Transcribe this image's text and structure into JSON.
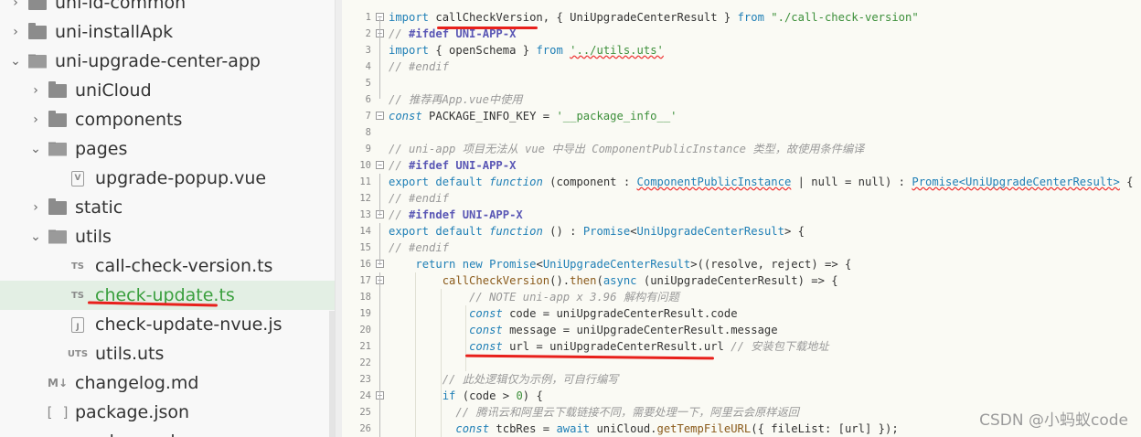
{
  "sidebar": {
    "items": [
      {
        "label": "uni-id-common",
        "chevron": "›",
        "icon": "folder-icon"
      },
      {
        "label": "uni-installApk",
        "chevron": "›",
        "icon": "folder-icon"
      },
      {
        "label": "uni-upgrade-center-app",
        "chevron": "⌄",
        "icon": "folder-open-icon"
      },
      {
        "label": "uniCloud",
        "chevron": "›",
        "icon": "folder-icon"
      },
      {
        "label": "components",
        "chevron": "›",
        "icon": "folder-icon"
      },
      {
        "label": "pages",
        "chevron": "⌄",
        "icon": "folder-open-icon"
      },
      {
        "label": "upgrade-popup.vue",
        "chevron": "",
        "icon": "vue-file-icon",
        "badge": "V"
      },
      {
        "label": "static",
        "chevron": "›",
        "icon": "folder-icon"
      },
      {
        "label": "utils",
        "chevron": "⌄",
        "icon": "folder-open-icon"
      },
      {
        "label": "call-check-version.ts",
        "chevron": "",
        "icon": "ts-file-icon",
        "badge": "TS"
      },
      {
        "label": "check-update.ts",
        "chevron": "",
        "icon": "ts-file-icon",
        "badge": "TS",
        "selected": true
      },
      {
        "label": "check-update-nvue.js",
        "chevron": "",
        "icon": "js-file-icon",
        "badge": "J"
      },
      {
        "label": "utils.uts",
        "chevron": "",
        "icon": "uts-file-icon",
        "badge": "UTS"
      },
      {
        "label": "changelog.md",
        "chevron": "",
        "icon": "md-file-icon",
        "badge": "M↓"
      },
      {
        "label": "package.json",
        "chevron": "",
        "icon": "json-file-icon",
        "badge": "[ ]"
      },
      {
        "label": "readme.md",
        "chevron": "",
        "icon": "md-file-icon",
        "badge": "M↓"
      }
    ]
  },
  "editor": {
    "lines": [
      {
        "n": "1",
        "fold": "−",
        "html": "<span class=\"kw\">import</span> callCheckVersion, { UniUpgradeCenterResult } <span class=\"kw\">from</span> <span class=\"str\">\"./call-check-version\"</span>"
      },
      {
        "n": "2",
        "fold": "−",
        "html": "<span class=\"cm\">// </span><span class=\"pp\">#ifdef UNI-APP-X</span>"
      },
      {
        "n": "3",
        "fold": "",
        "html": "<span class=\"kw\">import</span> { openSchema } <span class=\"kw\">from</span> <span class=\"str squig\">'../utils.uts'</span>"
      },
      {
        "n": "4",
        "fold": "",
        "html": "<span class=\"cm\">// #endif</span>"
      },
      {
        "n": "5",
        "fold": "",
        "html": ""
      },
      {
        "n": "6",
        "fold": "",
        "html": "<span class=\"cm\">// 推荐再App.vue中使用</span>"
      },
      {
        "n": "7",
        "fold": "−",
        "html": "<span class=\"it\">const</span> PACKAGE_INFO_KEY = <span class=\"str\">'__package_info__'</span>"
      },
      {
        "n": "8",
        "fold": "",
        "html": ""
      },
      {
        "n": "9",
        "fold": "",
        "html": "<span class=\"cm\">// uni-app 项目无法从 vue 中导出 ComponentPublicInstance 类型，故使用条件编译</span>"
      },
      {
        "n": "10",
        "fold": "−",
        "html": "<span class=\"cm\">// </span><span class=\"pp\">#ifdef UNI-APP-X</span>"
      },
      {
        "n": "11",
        "fold": "",
        "html": "<span class=\"kw\">export default</span> <span class=\"it\">function</span> (component : <span class=\"ty squig\">ComponentPublicInstance</span> | null = null) : <span class=\"ty squig\">Promise&lt;UniUpgradeCenterResult&gt;</span> {"
      },
      {
        "n": "12",
        "fold": "",
        "html": "<span class=\"cm\">// #endif</span>"
      },
      {
        "n": "13",
        "fold": "−",
        "html": "<span class=\"cm\">// </span><span class=\"pp\">#ifndef UNI-APP-X</span>"
      },
      {
        "n": "14",
        "fold": "",
        "html": "<span class=\"kw\">export default</span> <span class=\"it\">function</span> () : <span class=\"ty\">Promise</span>&lt;<span class=\"ty\">UniUpgradeCenterResult</span>&gt; {"
      },
      {
        "n": "15",
        "fold": "",
        "html": "<span class=\"cm\">// #endif</span>"
      },
      {
        "n": "16",
        "fold": "−",
        "html": "    <span class=\"kw\">return</span> <span class=\"kw\">new</span> <span class=\"ty\">Promise</span>&lt;<span class=\"ty\">UniUpgradeCenterResult</span>&gt;((resolve, reject) =&gt; {"
      },
      {
        "n": "17",
        "fold": "−",
        "html": "        <span class=\"fn\">callCheckVersion</span>().<span class=\"fn\">then</span>(<span class=\"kw\">async</span> (uniUpgradeCenterResult) =&gt; {"
      },
      {
        "n": "18",
        "fold": "",
        "html": "            <span class=\"cm\">// NOTE uni-app x 3.96 解构有问题</span>"
      },
      {
        "n": "19",
        "fold": "",
        "html": "            <span class=\"it\">const</span> code = uniUpgradeCenterResult.code"
      },
      {
        "n": "20",
        "fold": "",
        "html": "            <span class=\"it\">const</span> message = uniUpgradeCenterResult.message"
      },
      {
        "n": "21",
        "fold": "",
        "html": "            <span class=\"it\">const</span> url = uniUpgradeCenterResult.url <span class=\"cm\">// 安装包下载地址</span>"
      },
      {
        "n": "22",
        "fold": "",
        "html": ""
      },
      {
        "n": "23",
        "fold": "",
        "html": "        <span class=\"cm\">// 此处逻辑仅为示例，可自行编写</span>"
      },
      {
        "n": "24",
        "fold": "−",
        "html": "        <span class=\"kw\">if</span> (code &gt; <span class=\"str\">0</span>) {"
      },
      {
        "n": "25",
        "fold": "",
        "html": "          <span class=\"cm\">// 腾讯云和阿里云下载链接不同，需要处理一下，阿里云会原样返回</span>"
      },
      {
        "n": "26",
        "fold": "",
        "html": "          <span class=\"it\">const</span> tcbRes = <span class=\"kw\">await</span> uniCloud.<span class=\"fn\">getTempFileURL</span>({ fileList: [url] });"
      }
    ]
  },
  "watermark": "CSDN @小蚂蚁code",
  "colors": {
    "annotation_red": "#e8201b",
    "selected_text": "#3a9f3e",
    "selected_bg": "#e3efe4"
  }
}
